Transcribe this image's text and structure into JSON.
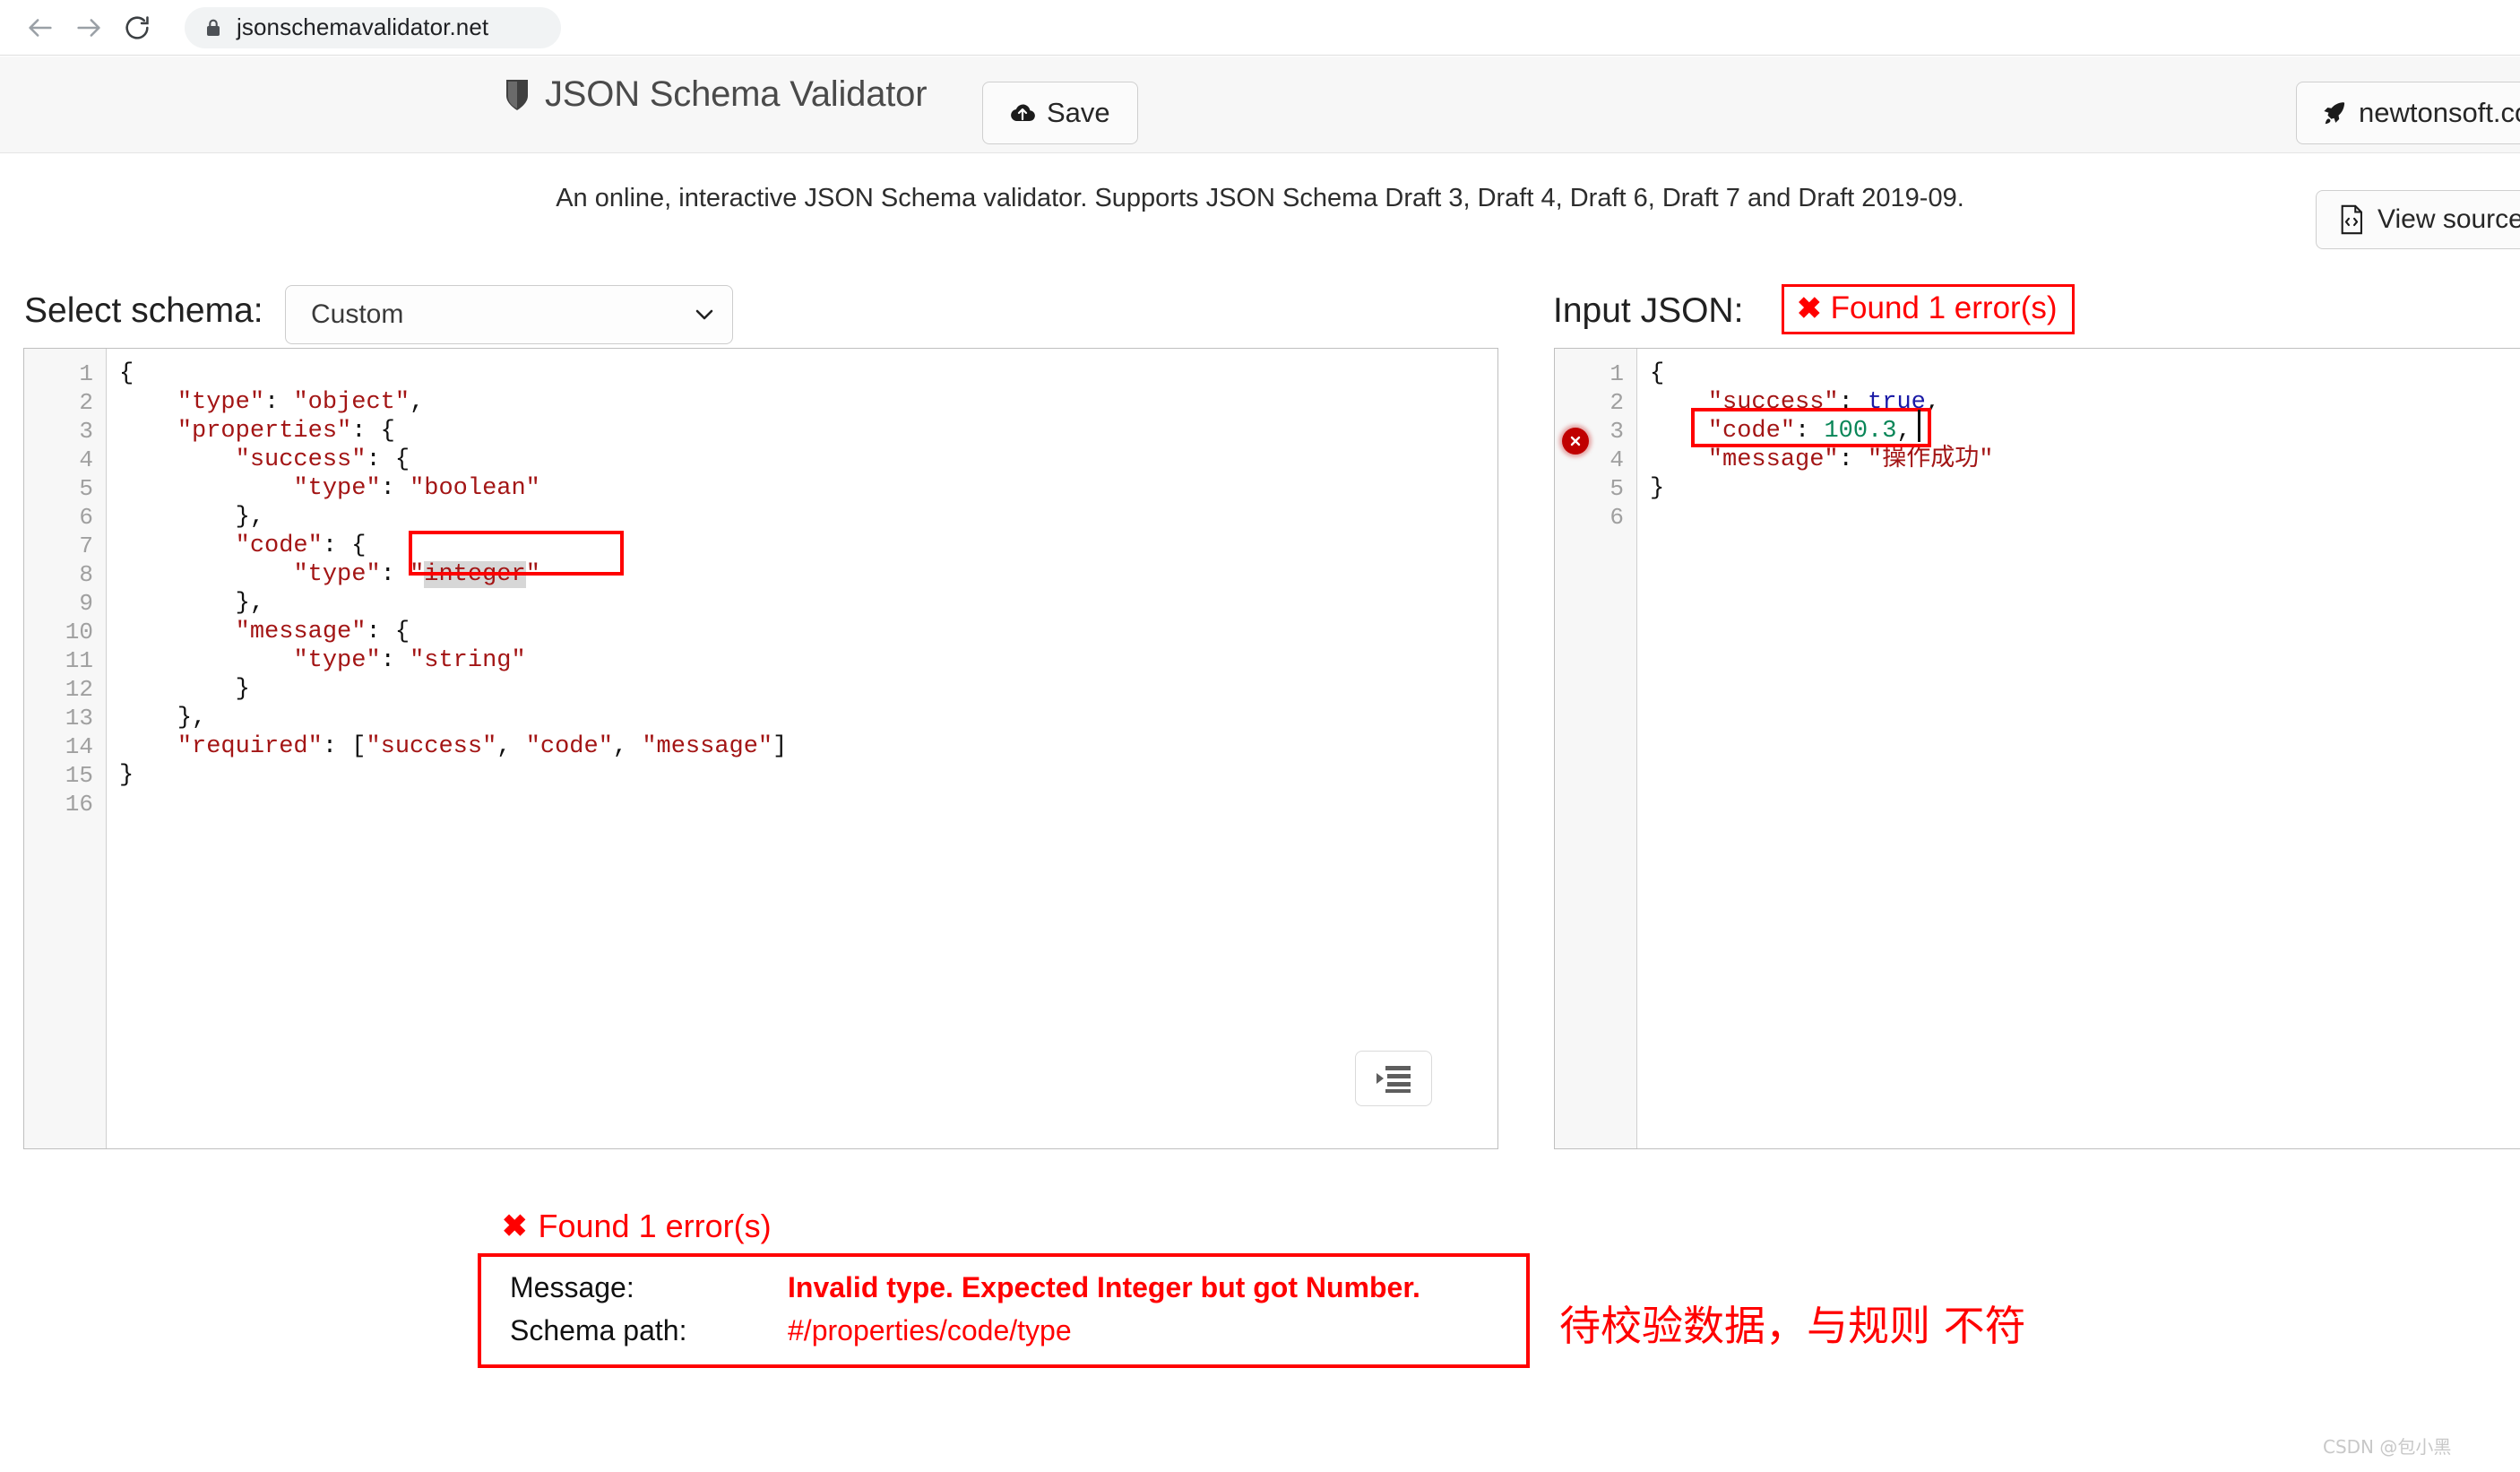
{
  "browser": {
    "back_icon": "arrow-left-icon",
    "forward_icon": "arrow-right-icon",
    "reload_icon": "reload-icon",
    "lock_icon": "lock-icon",
    "url": "jsonschemavalidator.net"
  },
  "header": {
    "shield_icon": "shield-icon",
    "title": "JSON Schema Validator",
    "save_label": "Save",
    "save_icon": "cloud-upload-icon",
    "newtonsoft_label": "newtonsoft.com",
    "rocket_icon": "rocket-icon"
  },
  "tagline": "An online, interactive JSON Schema validator. Supports JSON Schema Draft 3, Draft 4, Draft 6, Draft 7 and Draft 2019-09.",
  "view_source": {
    "label": "View source code",
    "icon": "code-file-icon"
  },
  "schema_panel": {
    "label": "Select schema:",
    "selected": "Custom",
    "options": [
      "Custom"
    ],
    "chevron_icon": "chevron-down-icon",
    "format_icon": "indent-format-icon",
    "line_numbers": [
      "1",
      "2",
      "3",
      "4",
      "5",
      "6",
      "7",
      "8",
      "9",
      "10",
      "11",
      "12",
      "13",
      "14",
      "15",
      "16"
    ],
    "lines": [
      "{",
      "    \"type\": \"object\",",
      "    \"properties\": {",
      "        \"success\": {",
      "            \"type\": \"boolean\"",
      "        },",
      "        \"code\": {",
      "            \"type\": \"integer\"",
      "        },",
      "        \"message\": {",
      "            \"type\": \"string\"",
      "        }",
      "    },",
      "    \"required\": [\"success\", \"code\", \"message\"]",
      "}",
      ""
    ]
  },
  "input_panel": {
    "label": "Input JSON:",
    "error_badge": "Found 1 error(s)",
    "error_x": "✖",
    "gutter_error_icon": "error-circle-icon",
    "line_numbers": [
      "1",
      "2",
      "3",
      "4",
      "5",
      "6"
    ],
    "lines": [
      "{",
      "    \"success\": true,",
      "    \"code\": 100.3,",
      "    \"message\": \"操作成功\"",
      "}",
      ""
    ]
  },
  "error_report": {
    "badge": "Found 1 error(s)",
    "error_x": "✖",
    "message_label": "Message:",
    "message_value": "Invalid type. Expected Integer but got Number.",
    "schema_path_label": "Schema path:",
    "schema_path_value": "#/properties/code/type"
  },
  "annotation": {
    "note": "待校验数据，与规则 不符"
  },
  "watermark": "CSDN @包小黑",
  "colors": {
    "error_red": "#ff0000",
    "json_string": "#a31515",
    "json_bool": "#1a1aa6",
    "json_number": "#098658"
  }
}
